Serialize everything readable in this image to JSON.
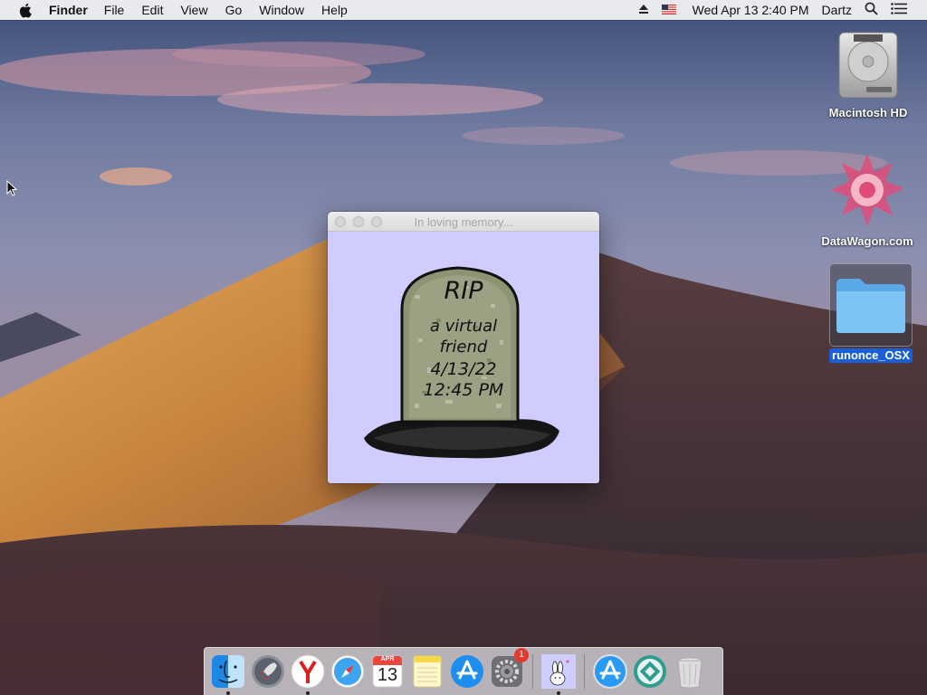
{
  "menubar": {
    "app_name": "Finder",
    "menus": [
      "File",
      "Edit",
      "View",
      "Go",
      "Window",
      "Help"
    ],
    "clock": "Wed Apr 13  2:40 PM",
    "user": "Dartz"
  },
  "desktop": {
    "icons": [
      {
        "label": "Macintosh HD",
        "icon": "hard-drive-icon"
      },
      {
        "label": "DataWagon.com",
        "icon": "datawagon-logo-icon"
      },
      {
        "label": "runonce_OSX",
        "icon": "folder-icon",
        "selected": true
      }
    ]
  },
  "window": {
    "title": "In loving memory...",
    "background": "#cfcdfd",
    "epitaph": {
      "heading": "RIP",
      "line1": "a virtual",
      "line2": "friend",
      "date": "4/13/22",
      "time": "12:45 PM"
    }
  },
  "dock": {
    "items": [
      {
        "name": "Finder",
        "icon": "finder-icon",
        "running": true
      },
      {
        "name": "Launchpad",
        "icon": "rocket-icon"
      },
      {
        "name": "Yandex Browser",
        "icon": "yandex-icon",
        "running": true
      },
      {
        "name": "Safari",
        "icon": "compass-icon"
      },
      {
        "name": "Calendar",
        "icon": "calendar-icon",
        "month": "APR",
        "day": "13"
      },
      {
        "name": "Notes",
        "icon": "notes-icon"
      },
      {
        "name": "App Store",
        "icon": "app-store-icon"
      },
      {
        "name": "System Preferences",
        "icon": "gear-icon",
        "badge": "1"
      },
      {
        "name": "Virtual Pet",
        "icon": "bunny-icon",
        "running": true
      },
      {
        "name": "App Store Downloads",
        "icon": "app-store-icon"
      },
      {
        "name": "Unknown App",
        "icon": "diamond-app-icon"
      },
      {
        "name": "Trash",
        "icon": "trash-icon"
      }
    ]
  },
  "colors": {
    "selection_blue": "#1b5fd6",
    "badge_red": "#e7382f",
    "window_bg": "#cfcdfd"
  }
}
